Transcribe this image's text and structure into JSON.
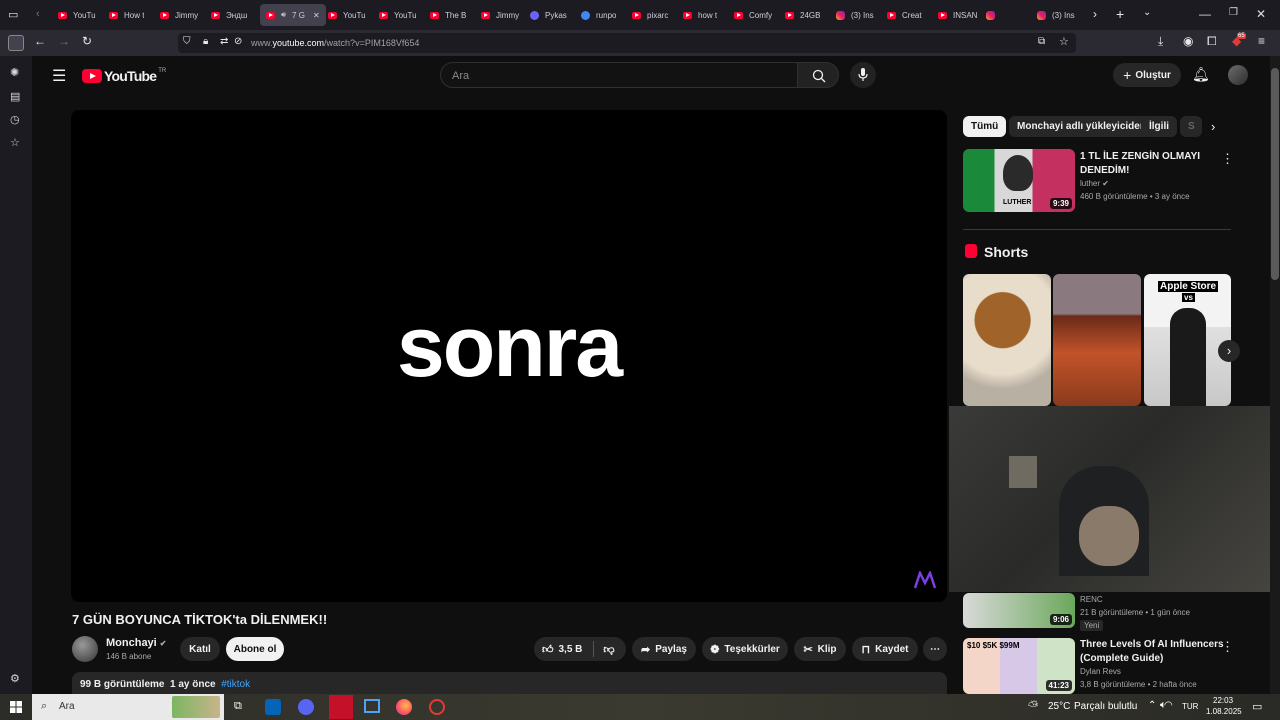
{
  "browser": {
    "tabs": [
      {
        "label": "YouTu",
        "favicon": "youtube-icon"
      },
      {
        "label": "How t",
        "favicon": "youtube-icon"
      },
      {
        "label": "Jimmy",
        "favicon": "youtube-icon"
      },
      {
        "label": "Эндш",
        "favicon": "youtube-icon"
      },
      {
        "label": "7 G",
        "favicon": "youtube-icon",
        "active": true
      },
      {
        "label": "YouTu",
        "favicon": "youtube-icon"
      },
      {
        "label": "YouTu",
        "favicon": "youtube-icon"
      },
      {
        "label": "The B",
        "favicon": "youtube-icon"
      },
      {
        "label": "Jimmy",
        "favicon": "youtube-icon"
      },
      {
        "label": "Pykas",
        "favicon": "pykaso-icon"
      },
      {
        "label": "runpo",
        "favicon": "google-icon"
      },
      {
        "label": "pixarc",
        "favicon": "youtube-icon"
      },
      {
        "label": "how t",
        "favicon": "youtube-icon"
      },
      {
        "label": "Comfy",
        "favicon": "youtube-icon"
      },
      {
        "label": "24GB",
        "favicon": "youtube-icon"
      },
      {
        "label": "(3) Ins",
        "favicon": "instagram-icon"
      },
      {
        "label": "Creat",
        "favicon": "youtube-icon"
      },
      {
        "label": "INSAN",
        "favicon": "youtube-icon"
      },
      {
        "label": "",
        "favicon": "extension-icon"
      },
      {
        "label": "(3) Ins",
        "favicon": "instagram-icon"
      }
    ],
    "url_prefix": "www.",
    "url_domain": "youtube.com",
    "url_path": "/watch?v=PIM168Vf654",
    "extension_badge": "65"
  },
  "youtube": {
    "logo_text": "YouTube",
    "logo_region": "TR",
    "search_placeholder": "Ara",
    "create_label": "Oluştur",
    "video": {
      "overlay_text": "sonra",
      "title": "7 GÜN BOYUNCA TİKTOK'ta DİLENMEK!!",
      "channel": "Monchayi",
      "subscribers": "146 B abone",
      "join_label": "Katıl",
      "subscribe_label": "Abone ol",
      "likes": "3,5 B",
      "share_label": "Paylaş",
      "thanks_label": "Teşekkürler",
      "clip_label": "Klip",
      "save_label": "Kaydet",
      "views": "99 B görüntüleme",
      "age": "1 ay önce",
      "hashtag": "#tiktok"
    },
    "chips": [
      "Tümü",
      "Monchayi adlı yükleyiciden",
      "İlgili",
      "S"
    ],
    "related": [
      {
        "title_line1": "1 TL İLE ZENGİN OLMAYI",
        "title_line2": "DENEDİM!",
        "channel": "luther",
        "meta": "460 B görüntüleme • 3 ay önce",
        "duration": "9:39",
        "thumb_text": "LUTHER"
      },
      {
        "title_line1": "",
        "title_line2": "",
        "channel": "RENC",
        "meta": "21 B görüntüleme • 1 gün önce",
        "duration": "9:06",
        "badge": "Yeni"
      },
      {
        "title_line1": "Three Levels Of AI Influencers",
        "title_line2": "(Complete Guide)",
        "channel": "Dylan Revs",
        "meta": "3,8 B görüntüleme • 2 hafta önce",
        "duration": "41:23",
        "thumb_text": "$10 $5K $99M"
      }
    ],
    "shorts_label": "Shorts",
    "shorts_overlay_text": "Apple Store",
    "shorts_overlay_vs": "vs"
  },
  "taskbar": {
    "search_label": "Ara",
    "weather_temp": "25°C",
    "weather_desc": "Parçalı bulutlu",
    "lang": "TUR",
    "time": "22:03",
    "date": "1.08.2025"
  }
}
